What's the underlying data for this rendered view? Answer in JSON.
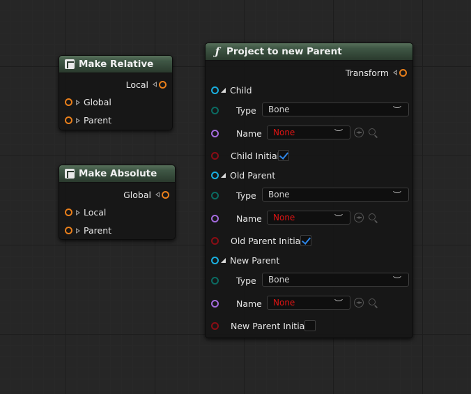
{
  "nodes": {
    "make_relative": {
      "title": "Make Relative",
      "output": "Local",
      "inputs": [
        "Global",
        "Parent"
      ]
    },
    "make_absolute": {
      "title": "Make Absolute",
      "output": "Global",
      "inputs": [
        "Local",
        "Parent"
      ]
    },
    "project": {
      "title": "Project to new Parent",
      "output": "Transform",
      "type_label": "Type",
      "name_label": "Name",
      "groups": [
        {
          "label": "Child",
          "type_value": "Bone",
          "name_value": "None",
          "initial_label": "Child Initial",
          "initial_checked": true
        },
        {
          "label": "Old Parent",
          "type_value": "Bone",
          "name_value": "None",
          "initial_label": "Old Parent Initial",
          "initial_checked": true
        },
        {
          "label": "New Parent",
          "type_value": "Bone",
          "name_value": "None",
          "initial_label": "New Parent Initial",
          "initial_checked": false
        }
      ]
    }
  },
  "colors": {
    "transform_pin": "#e97f1b",
    "struct_pin": "#19b0e0",
    "enum_pin": "#0b6a62",
    "name_pin": "#a46bde",
    "bool_pin": "#8c0d14",
    "none_value": "#e21414",
    "check": "#2e86e8"
  }
}
